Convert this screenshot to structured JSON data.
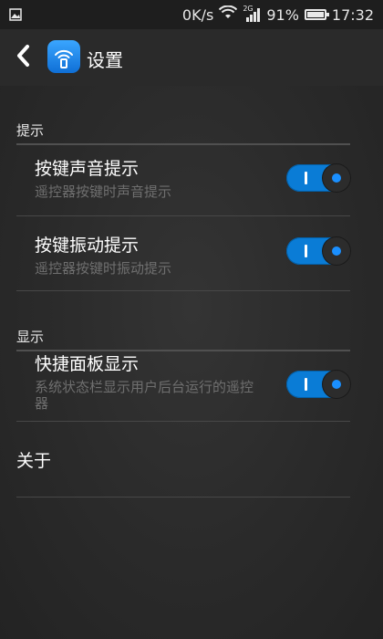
{
  "status_bar": {
    "speed": "0K/s",
    "network": "2G",
    "battery_percent_text": "91%",
    "battery_level": 0.91,
    "time": "17:32"
  },
  "app_bar": {
    "title": "设置",
    "back_icon": "chevron-left-icon",
    "app_icon": "remote-wifi-icon"
  },
  "sections": {
    "hints": {
      "header": "提示",
      "items": [
        {
          "title": "按键声音提示",
          "summary": "遥控器按键时声音提示",
          "enabled": true
        },
        {
          "title": "按键振动提示",
          "summary": "遥控器按键时振动提示",
          "enabled": true
        }
      ]
    },
    "display": {
      "header": "显示",
      "items": [
        {
          "title": "快捷面板显示",
          "summary": "系统状态栏显示用户后台运行的遥控器",
          "enabled": true
        }
      ]
    }
  },
  "about": {
    "label": "关于"
  },
  "colors": {
    "accent": "#0a7cd6",
    "background": "#2b2b2b",
    "summary_text": "#6f6f6f"
  }
}
